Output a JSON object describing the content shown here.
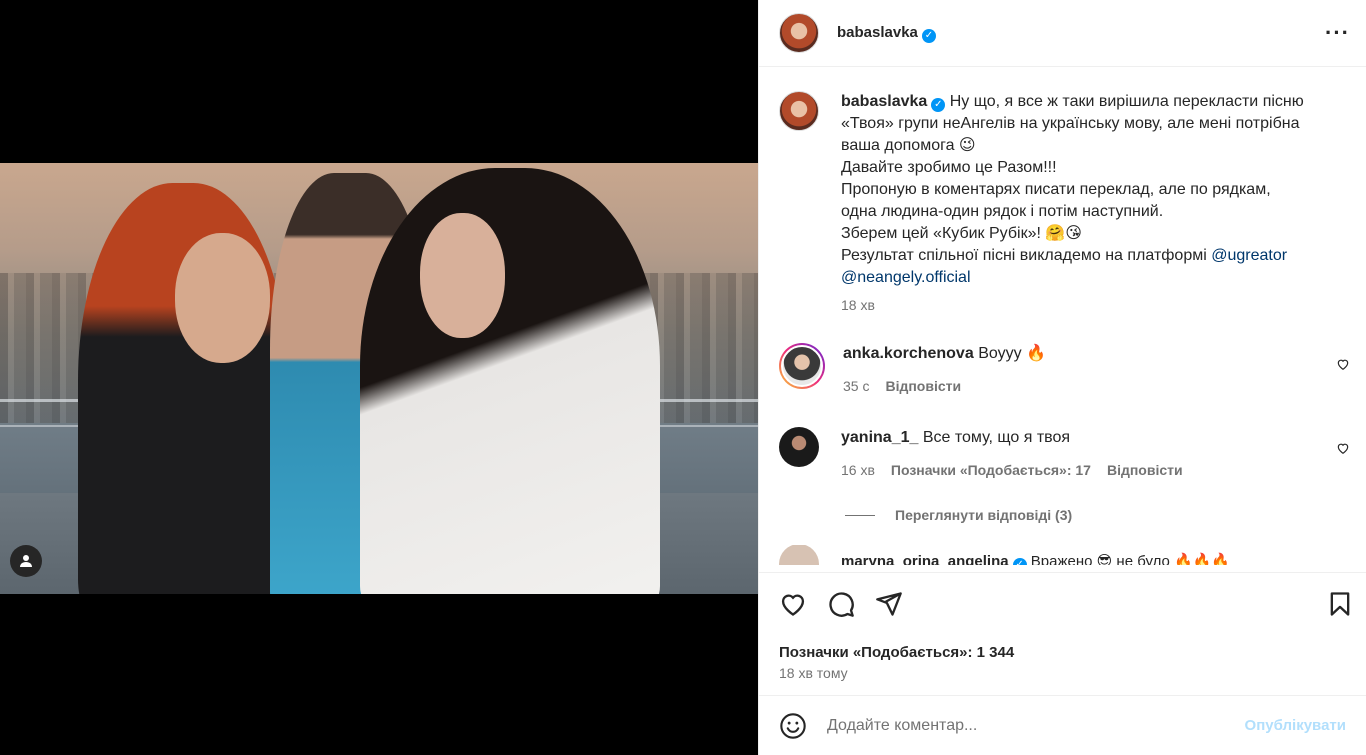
{
  "post": {
    "username": "babaslavka",
    "verified_icon": "verified-badge-icon",
    "more_icon": "more-options-icon",
    "caption_lines": [
      "Ну що, я все ж таки вирішила перекласти пісню",
      "«Твоя» групи неАнгелів на українську мову, але мені потрібна",
      "ваша допомога 😉",
      "Давайте зробимо це Разом!!!",
      "Пропоную в коментарях писати переклад, але по рядкам,",
      "одна людина-один рядок і потім наступний.",
      "Зберем цей «Кубик Рубік»! 🤗😘",
      "Результат спільної пісні викладемо на платформі"
    ],
    "mention_1": "@ugreator",
    "mention_2": "@neangely.official",
    "caption_time": "18 хв"
  },
  "comments": [
    {
      "username": "anka.korchenova",
      "text": "Воууу 🔥",
      "time": "35 с",
      "reply": "Відповісти"
    },
    {
      "username": "yanina_1_",
      "text": "Все тому, що я твоя",
      "time": "16 хв",
      "likes": "Позначки «Подобається»: 17",
      "reply": "Відповісти"
    }
  ],
  "view_replies": "Переглянути відповіді (3)",
  "peek_comment": {
    "username": "maryna_orina_angelina",
    "text": "Вражено 😎 не було 🔥🔥🔥"
  },
  "likes_text": "Позначки «Подобається»: 1 344",
  "posted_ago": "18 хв тому",
  "composer": {
    "placeholder": "Додайте коментар...",
    "post_label": "Опублікувати"
  },
  "colors": {
    "link": "#00376b",
    "muted": "#737373",
    "accent": "#0095f6",
    "post_button_disabled": "#b2dffc"
  }
}
